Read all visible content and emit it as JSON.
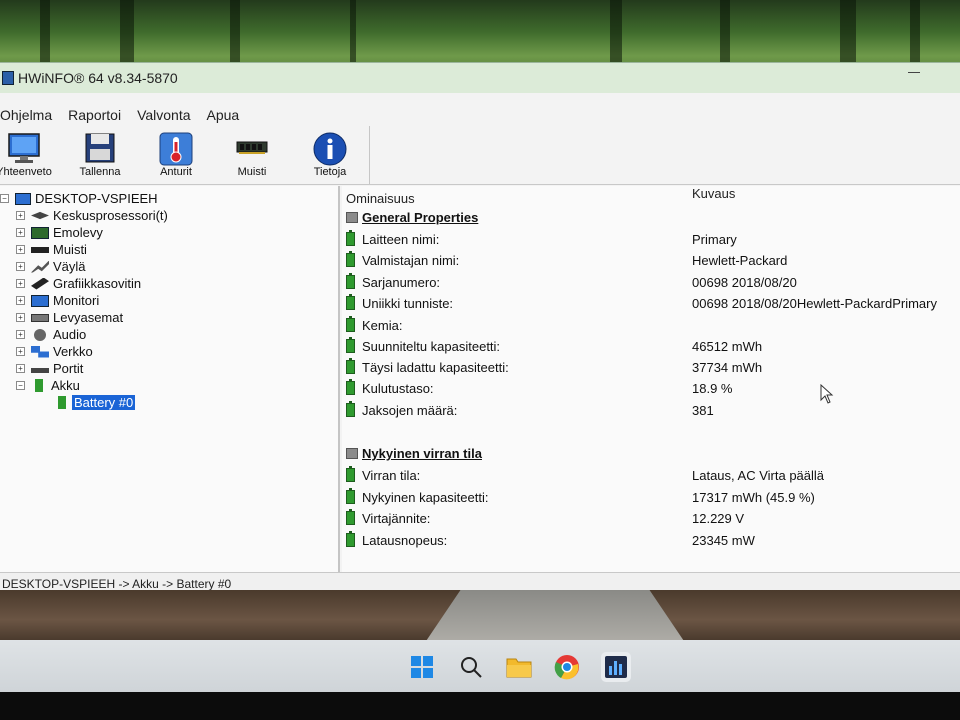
{
  "window": {
    "title": "HWiNFO® 64 v8.34-5870"
  },
  "menu": [
    "Ohjelma",
    "Raportoi",
    "Valvonta",
    "Apua"
  ],
  "toolbar": [
    {
      "label": "Yhteenveto",
      "icon": "monitor-icon"
    },
    {
      "label": "Tallenna",
      "icon": "floppy-icon"
    },
    {
      "label": "Anturit",
      "icon": "thermometer-icon"
    },
    {
      "label": "Muisti",
      "icon": "memory-icon"
    },
    {
      "label": "Tietoja",
      "icon": "info-icon"
    }
  ],
  "tree": {
    "root": "DESKTOP-VSPIEEH",
    "items": [
      {
        "label": "Keskusprosessori(t)",
        "icon": "cpu-icon"
      },
      {
        "label": "Emolevy",
        "icon": "motherboard-icon"
      },
      {
        "label": "Muisti",
        "icon": "memory-icon"
      },
      {
        "label": "Väylä",
        "icon": "bus-icon"
      },
      {
        "label": "Grafiikkasovitin",
        "icon": "gpu-icon"
      },
      {
        "label": "Monitori",
        "icon": "monitor-icon"
      },
      {
        "label": "Levyasemat",
        "icon": "drive-icon"
      },
      {
        "label": "Audio",
        "icon": "audio-icon"
      },
      {
        "label": "Verkko",
        "icon": "network-icon"
      },
      {
        "label": "Portit",
        "icon": "ports-icon"
      },
      {
        "label": "Akku",
        "icon": "battery-icon"
      }
    ],
    "selected": "Battery #0"
  },
  "detail": {
    "col_property": "Ominaisuus",
    "col_value": "Kuvaus",
    "sections": [
      {
        "title": "General Properties",
        "rows": [
          {
            "name": "Laitteen nimi:",
            "value": "Primary"
          },
          {
            "name": "Valmistajan nimi:",
            "value": "Hewlett-Packard"
          },
          {
            "name": "Sarjanumero:",
            "value": "00698 2018/08/20"
          },
          {
            "name": "Uniikki tunniste:",
            "value": "00698 2018/08/20Hewlett-PackardPrimary"
          },
          {
            "name": "Kemia:",
            "value": ""
          },
          {
            "name": "Suunniteltu kapasiteetti:",
            "value": "46512 mWh"
          },
          {
            "name": "Täysi ladattu kapasiteetti:",
            "value": "37734 mWh"
          },
          {
            "name": "Kulutustaso:",
            "value": "18.9 %"
          },
          {
            "name": "Jaksojen määrä:",
            "value": "381"
          }
        ]
      },
      {
        "title": "Nykyinen virran tila",
        "rows": [
          {
            "name": "Virran tila:",
            "value": "Lataus, AC Virta päällä"
          },
          {
            "name": "Nykyinen kapasiteetti:",
            "value": "17317 mWh (45.9 %)"
          },
          {
            "name": "Virtajännite:",
            "value": "12.229 V"
          },
          {
            "name": "Latausnopeus:",
            "value": "23345 mW"
          }
        ]
      }
    ]
  },
  "status": "DESKTOP-VSPIEEH -> Akku -> Battery #0",
  "taskbar": [
    "start-icon",
    "search-icon",
    "file-explorer-icon",
    "chrome-icon",
    "hwinfo-icon"
  ]
}
